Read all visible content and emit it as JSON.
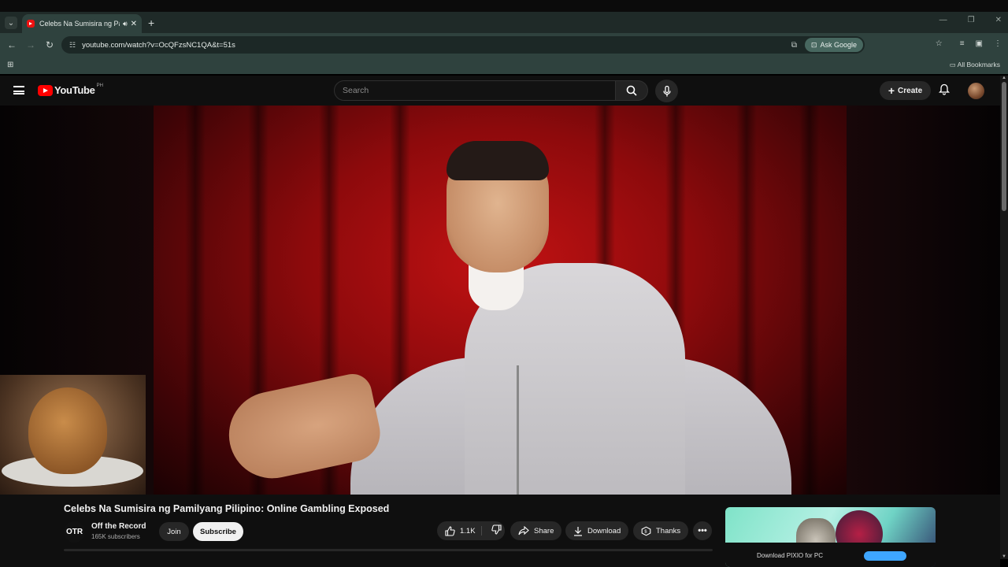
{
  "browser": {
    "tab_title": "Celebs Na Sumisira ng Pam",
    "new_tab": "+",
    "url": "youtube.com/watch?v=OcQFzsNC1QA&t=51s",
    "ask_google": "Ask Google",
    "all_bookmarks": "All Bookmarks"
  },
  "youtube": {
    "logo_text": "YouTube",
    "country_code": "PH",
    "search_placeholder": "Search",
    "create_label": "Create"
  },
  "video": {
    "title": "Celebs Na Sumisira ng Pamilyang Pilipino: Online Gambling Exposed",
    "channel_logo_text": "OTR",
    "channel_name": "Off the Record",
    "subscribers": "165K subscribers",
    "join_label": "Join",
    "subscribe_label": "Subscribe",
    "like_count": "1.1K",
    "share_label": "Share",
    "download_label": "Download",
    "thanks_label": "Thanks",
    "more_label": "•••"
  },
  "ad": {
    "text": "Download PIXIO for PC"
  },
  "icons": {
    "tab_audio": "speaker-icon",
    "back": "back-arrow-icon",
    "forward": "forward-arrow-icon",
    "reload": "reload-icon",
    "star": "star-icon",
    "like": "thumbs-up-icon",
    "dislike": "thumbs-down-icon"
  },
  "colors": {
    "browser_chrome": "#2f423e",
    "youtube_bg": "#0f0f0f",
    "youtube_red": "#ff0000",
    "subscribe_bg": "#f1f1f1"
  }
}
